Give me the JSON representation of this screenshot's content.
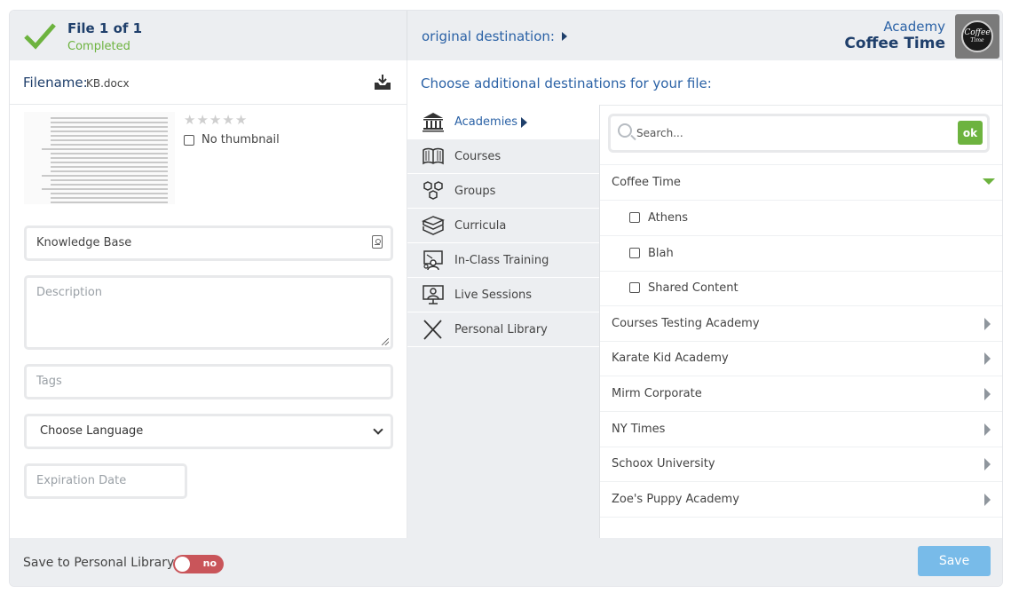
{
  "header": {
    "file_count": "File 1 of 1",
    "file_status": "Completed",
    "original_destination": "original destination:",
    "academy_label": "Academy",
    "academy_name": "Coffee Time",
    "logo_text_1": "Coffee",
    "logo_text_2": "Time"
  },
  "file": {
    "filename_label": "Filename:",
    "filename_value": "KB.docx",
    "stars": [
      "★",
      "★",
      "★",
      "★",
      "★"
    ],
    "no_thumbnail_label": "No thumbnail",
    "title_value": "Knowledge Base",
    "description_placeholder": "Description",
    "tags_placeholder": "Tags",
    "language_value": "Choose Language",
    "expiration_placeholder": "Expiration Date"
  },
  "destinations": {
    "heading": "Choose additional destinations for your file:",
    "nav": [
      {
        "label": "Academies",
        "icon": "academy-building-icon"
      },
      {
        "label": "Courses",
        "icon": "open-book-icon"
      },
      {
        "label": "Groups",
        "icon": "hexagons-icon"
      },
      {
        "label": "Curricula",
        "icon": "stacked-books-icon"
      },
      {
        "label": "In-Class Training",
        "icon": "classroom-icon"
      },
      {
        "label": "Live Sessions",
        "icon": "presentation-screen-icon"
      },
      {
        "label": "Personal Library",
        "icon": "crossed-tools-icon"
      }
    ],
    "search_placeholder": "Search...",
    "ok_label": "ok",
    "expanded_academy": "Coffee Time",
    "sub_items": [
      "Athens",
      "Blah",
      "Shared Content"
    ],
    "academies": [
      "Courses Testing Academy",
      "Karate Kid Academy",
      "Mirm Corporate",
      "NY Times",
      "Schoox University",
      "Zoe's Puppy Academy"
    ]
  },
  "footer": {
    "save_personal_label": "Save to Personal Library",
    "toggle_label": "no",
    "save_button": "Save"
  },
  "colors": {
    "accent_green": "#6db33f",
    "title_blue": "#1f3f6b",
    "link_blue": "#2b62a6",
    "toggle_red": "#c9555a",
    "save_blue": "#78bbe9"
  }
}
